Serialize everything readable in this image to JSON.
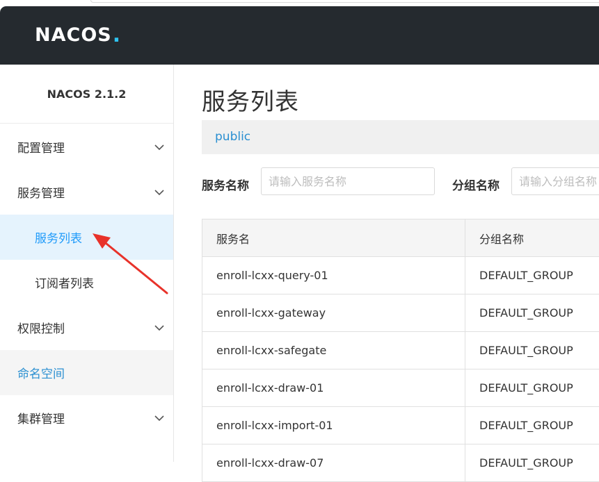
{
  "header": {
    "logo_prefix": "NAC",
    "logo_o": "O",
    "logo_suffix": "S",
    "logo_dot": "."
  },
  "sidebar": {
    "version": "NACOS 2.1.2",
    "items": [
      {
        "label": "配置管理"
      },
      {
        "label": "服务管理"
      },
      {
        "label": "服务列表"
      },
      {
        "label": "订阅者列表"
      },
      {
        "label": "权限控制"
      },
      {
        "label": "命名空间"
      },
      {
        "label": "集群管理"
      }
    ]
  },
  "main": {
    "title": "服务列表",
    "namespace": "public",
    "filters": {
      "service_name_label": "服务名称",
      "service_name_placeholder": "请输入服务名称",
      "group_name_label": "分组名称",
      "group_name_placeholder": "请输入分组名称"
    },
    "table": {
      "headers": [
        "服务名",
        "分组名称"
      ],
      "rows": [
        [
          "enroll-lcxx-query-01",
          "DEFAULT_GROUP"
        ],
        [
          "enroll-lcxx-gateway",
          "DEFAULT_GROUP"
        ],
        [
          "enroll-lcxx-safegate",
          "DEFAULT_GROUP"
        ],
        [
          "enroll-lcxx-draw-01",
          "DEFAULT_GROUP"
        ],
        [
          "enroll-lcxx-import-01",
          "DEFAULT_GROUP"
        ],
        [
          "enroll-lcxx-draw-07",
          "DEFAULT_GROUP"
        ]
      ]
    }
  },
  "colors": {
    "header_bg": "#252a2f",
    "accent": "#209bfa",
    "annotation_arrow": "#e8322a"
  }
}
